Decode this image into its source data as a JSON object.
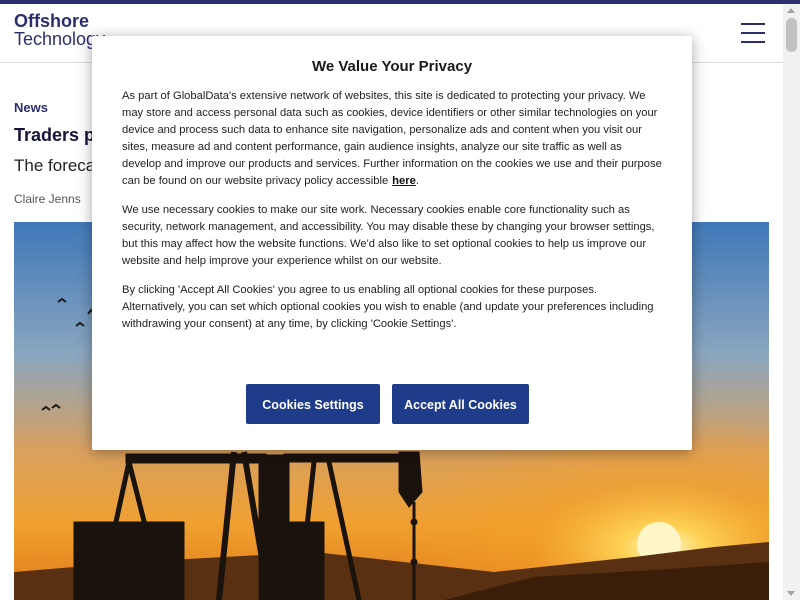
{
  "header": {
    "logo_line1": "Offshore",
    "logo_line2": "Technology",
    "menu_icon": "hamburger-menu-icon"
  },
  "article": {
    "category": "News",
    "headline": "Traders p",
    "standfirst": "The foreca",
    "author": "Claire Jenns",
    "hero_image": "oil-pumpjacks-at-sunset"
  },
  "cookie_modal": {
    "title": "We Value Your Privacy",
    "paragraph1": "As part of GlobalData's extensive network of websites, this site is dedicated to protecting your privacy. We may store and access personal data such as cookies, device identifiers or other similar technologies on your device and process such data to enhance site navigation, personalize ads and content when you visit our sites, measure ad and content performance, gain audience insights, analyze our site traffic as well as develop and improve our products and services. Further information on the cookies we use and their purpose can be found on our website privacy policy accessible",
    "paragraph1_link": "here",
    "paragraph1_end": ".",
    "paragraph2": "We use necessary cookies to make our site work. Necessary cookies enable core functionality such as security, network management, and accessibility. You may disable these by changing your browser settings, but this may affect how the website functions. We'd also like to set optional cookies to help us improve our website and help improve your experience whilst on our website.",
    "paragraph3": "By clicking 'Accept All Cookies' you agree to us enabling all optional cookies for these purposes. Alternatively, you can set which optional cookies you wish to enable (and update your preferences including withdrawing your consent) at any time, by clicking 'Cookie Settings'.",
    "settings_button": "Cookies Settings",
    "accept_button": "Accept All Cookies"
  },
  "colors": {
    "brand": "#2b2f6e",
    "button": "#1e3c8a"
  }
}
